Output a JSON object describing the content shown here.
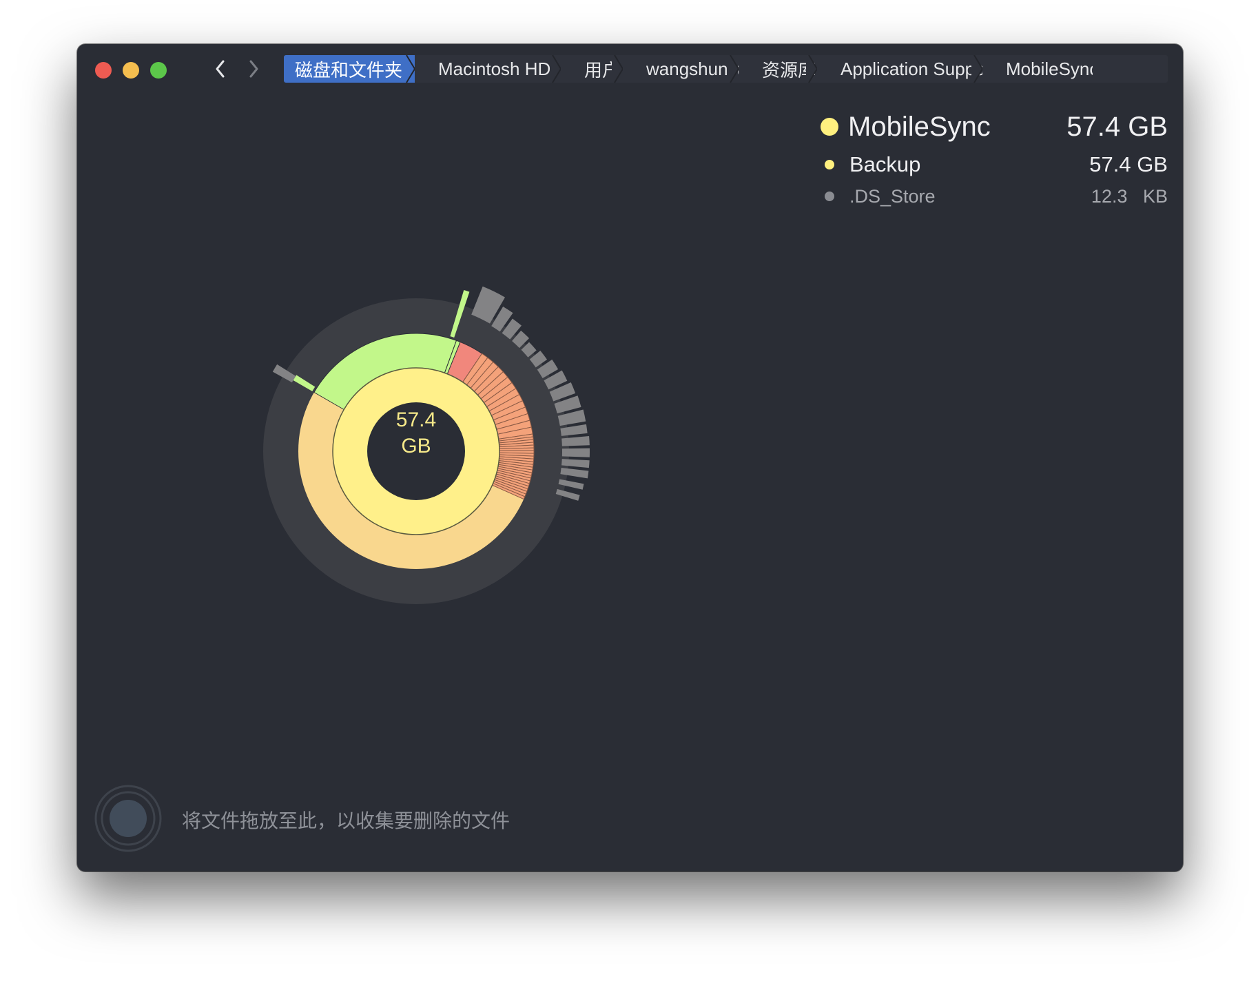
{
  "window": {
    "controls": [
      "close",
      "minimize",
      "zoom"
    ],
    "nav": {
      "back_icon": "chevron-left-icon",
      "forward_icon": "chevron-right-icon"
    }
  },
  "breadcrumb": [
    {
      "label": "磁盘和文件夹",
      "active": true
    },
    {
      "label": "Macintosh HD",
      "active": false
    },
    {
      "label": "用户",
      "active": false
    },
    {
      "label": "wangshunyu",
      "active": false
    },
    {
      "label": "资源库",
      "active": false
    },
    {
      "label": "Application Support",
      "active": false
    },
    {
      "label": "MobileSync",
      "active": false
    }
  ],
  "legend": {
    "main": {
      "name": "MobileSync",
      "size": "57.4 GB",
      "color": "#fff07f"
    },
    "items": [
      {
        "name": "Backup",
        "size": "57.4 GB",
        "color": "#fff07f",
        "dim": false
      },
      {
        "name": ".DS_Store",
        "size": "12.3   KB",
        "color": "#8a8c92",
        "dim": true
      }
    ]
  },
  "chart": {
    "center_line1": "57.4",
    "center_line2": "GB",
    "colors": {
      "center": "#2a2d35",
      "ring1": "#fff08a",
      "ring2": "#f9d78e",
      "green": "#c2f78a",
      "salmon": "#f1877c",
      "orange": "#f4a27a",
      "gray": "#838385",
      "track": "#3c3e44"
    }
  },
  "dropzone": {
    "text": "将文件拖放至此，以收集要删除的文件",
    "icon": "drop-target-icon"
  }
}
